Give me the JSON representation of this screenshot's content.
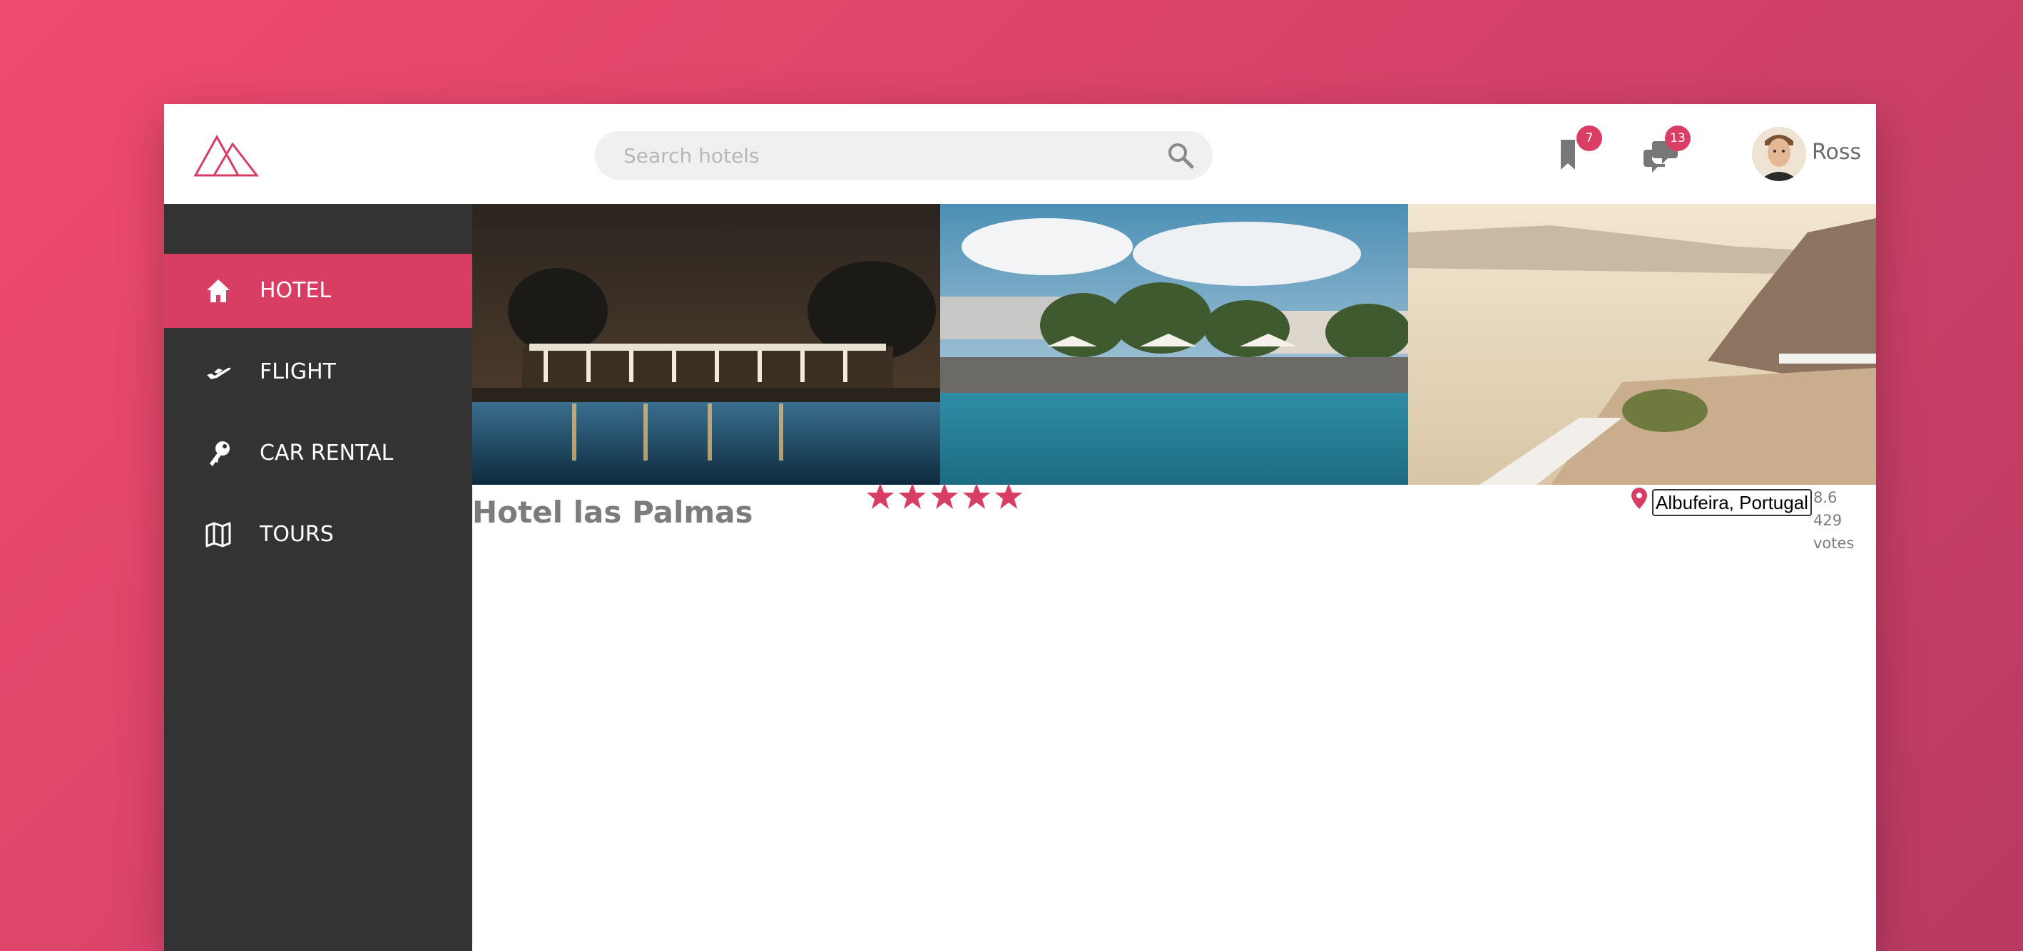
{
  "header": {
    "logo": "mountain-logo",
    "search_placeholder": "Search hotels",
    "bookmarks_count": "7",
    "messages_count": "13",
    "user_name": "Ross"
  },
  "sidebar": {
    "items": [
      {
        "label": "HOTEL",
        "icon": "home-icon",
        "active": true
      },
      {
        "label": "FLIGHT",
        "icon": "plane-icon",
        "active": false
      },
      {
        "label": "CAR RENTAL",
        "icon": "key-icon",
        "active": false
      },
      {
        "label": "TOURS",
        "icon": "map-icon",
        "active": false
      }
    ]
  },
  "hotel": {
    "name": "Hotel las Palmas",
    "stars": 5,
    "location": "Albufeira, Portugal",
    "score": "8.6",
    "votes": "429 votes"
  },
  "colors": {
    "accent": "#d83d64",
    "sidebar": "#333333",
    "background_gradient_start": "#ee4a6d",
    "background_gradient_end": "#b93a62"
  }
}
